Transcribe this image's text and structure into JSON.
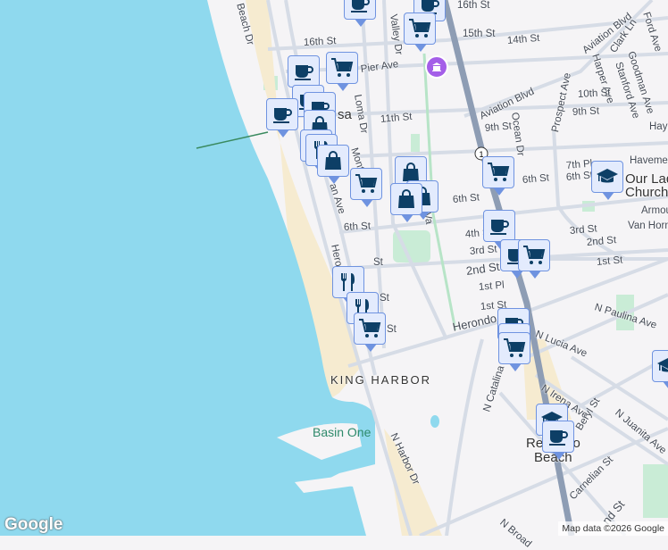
{
  "map": {
    "colors": {
      "water": "#8fd9ee",
      "land": "#f5f4f6",
      "sand": "#f6ebd0",
      "road": "#d6dce6",
      "highway": "#8e9db4",
      "park": "#c9ecd6",
      "marker_bg": "#e3ebfd",
      "marker_border": "#6f93e0",
      "icon": "#0d3f66",
      "museum": "#a45ee8"
    },
    "place_labels": {
      "hermosa": "sa",
      "king_harbor": "KING HARBOR",
      "basin_one": "Basin One",
      "redondo": "Redondo",
      "redondo2": "Beach",
      "church1": "Our Lad",
      "church2": "Church"
    },
    "streets": [
      "Beach Dr",
      "16th St",
      "16th St",
      "15th St",
      "14th St",
      "Pier Ave",
      "Loma Dr",
      "Valley Dr",
      "11th St",
      "Aviation Blvd",
      "Aviation Blvd",
      "Prospect Ave",
      "Harper Ave",
      "Clark Ln",
      "Stanford Ave",
      "Goodman Ave",
      "Ford Ave",
      "10th St",
      "9th St",
      "9th St",
      "Ocean Dr",
      "Hayn",
      "Havemey",
      "7th Pl",
      "6th St",
      "6th St",
      "6th St",
      "6th St",
      "Monte",
      "an Ave",
      "Armou",
      "Van Horn",
      "4th St",
      "3rd St",
      "3rd St",
      "2nd St",
      "2nd St",
      "1st St",
      "1st Pl",
      "1st St",
      "Herondo",
      "Herondo St",
      "N Paulina Ave",
      "N Lucia Ave",
      "N Irena Ave",
      "N Catalina",
      "Beryl St",
      "N Juanita Ave",
      "N Harbor Dr",
      "Carnelian St",
      "N Broad",
      "nd St",
      "St",
      "St",
      "St",
      "Va"
    ],
    "highway_shield": "1",
    "markers": [
      "coffee",
      "coffee",
      "cart",
      "coffee",
      "cart",
      "coffee",
      "coffee",
      "coffee",
      "bag",
      "restaurant",
      "restaurant",
      "bag",
      "cart",
      "bag",
      "bag",
      "bag",
      "cart",
      "coffee",
      "coffee",
      "cart",
      "education",
      "restaurant",
      "restaurant",
      "cart",
      "coffee",
      "coffee",
      "cart",
      "education",
      "education",
      "coffee"
    ],
    "logo": "Google",
    "attribution": "Map data ©2026 Google"
  }
}
